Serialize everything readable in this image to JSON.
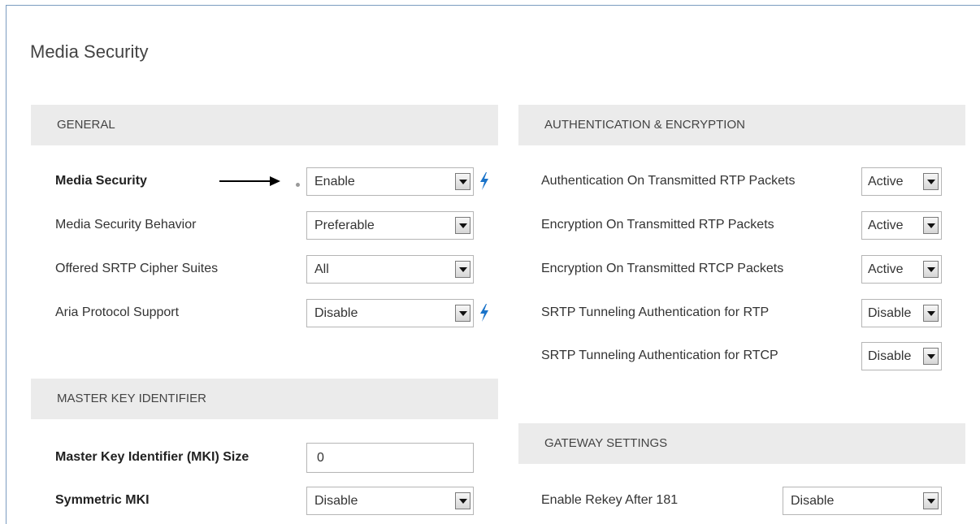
{
  "page": {
    "title": "Media Security"
  },
  "general": {
    "header": "GENERAL",
    "media_security": {
      "label": "Media Security",
      "value": "Enable"
    },
    "media_security_behavior": {
      "label": "Media Security Behavior",
      "value": "Preferable"
    },
    "offered_srtp_cipher_suites": {
      "label": "Offered SRTP Cipher Suites",
      "value": "All"
    },
    "aria_protocol_support": {
      "label": "Aria Protocol Support",
      "value": "Disable"
    }
  },
  "mki": {
    "header": "MASTER KEY IDENTIFIER",
    "mki_size": {
      "label": "Master Key Identifier (MKI) Size",
      "value": "0"
    },
    "symmetric_mki": {
      "label": "Symmetric MKI",
      "value": "Disable"
    }
  },
  "auth_enc": {
    "header": "AUTHENTICATION & ENCRYPTION",
    "auth_rtp": {
      "label": "Authentication On Transmitted RTP Packets",
      "value": "Active"
    },
    "enc_rtp": {
      "label": "Encryption On Transmitted RTP Packets",
      "value": "Active"
    },
    "enc_rtcp": {
      "label": "Encryption On Transmitted RTCP Packets",
      "value": "Active"
    },
    "tunnel_rtp": {
      "label": "SRTP Tunneling Authentication for RTP",
      "value": "Disable"
    },
    "tunnel_rtcp": {
      "label": "SRTP Tunneling Authentication for RTCP",
      "value": "Disable"
    }
  },
  "gateway": {
    "header": "GATEWAY SETTINGS",
    "rekey_181": {
      "label": "Enable Rekey After 181",
      "value": "Disable"
    }
  },
  "icons": {
    "bolt": "lightning-icon",
    "dropdown": "chevron-down-icon",
    "arrow": "arrow-right-icon",
    "bolt_color": "#1a73c9"
  }
}
